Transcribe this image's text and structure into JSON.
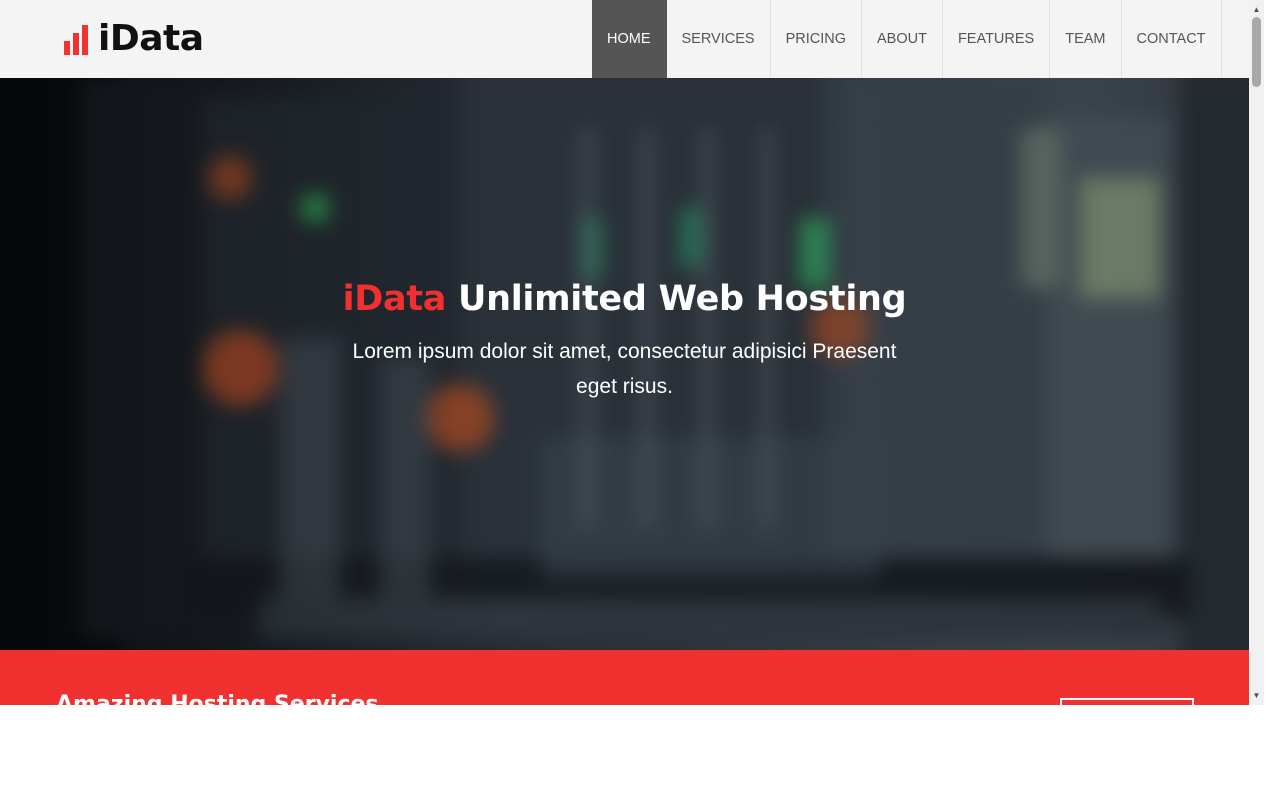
{
  "brand": {
    "name": "iData",
    "accent_color": "#f13030",
    "icon": "bar-chart-icon"
  },
  "nav": {
    "items": [
      {
        "label": "HOME",
        "active": true
      },
      {
        "label": "SERVICES"
      },
      {
        "label": "PRICING"
      },
      {
        "label": "ABOUT"
      },
      {
        "label": "FEATURES"
      },
      {
        "label": "TEAM"
      },
      {
        "label": "CONTACT"
      }
    ]
  },
  "hero": {
    "title_accent": "iData",
    "title_rest": "Unlimited Web Hosting",
    "subtitle": "Lorem ipsum dolor sit amet, consectetur adipisici Praesent eget risus.",
    "background": "blurred-server-rack-image"
  },
  "band": {
    "title": "Amazing Hosting Services",
    "color": "#f13030"
  },
  "colors": {
    "header_bg": "#f4f4f4",
    "nav_active_bg": "#555555",
    "nav_text": "#555555"
  }
}
